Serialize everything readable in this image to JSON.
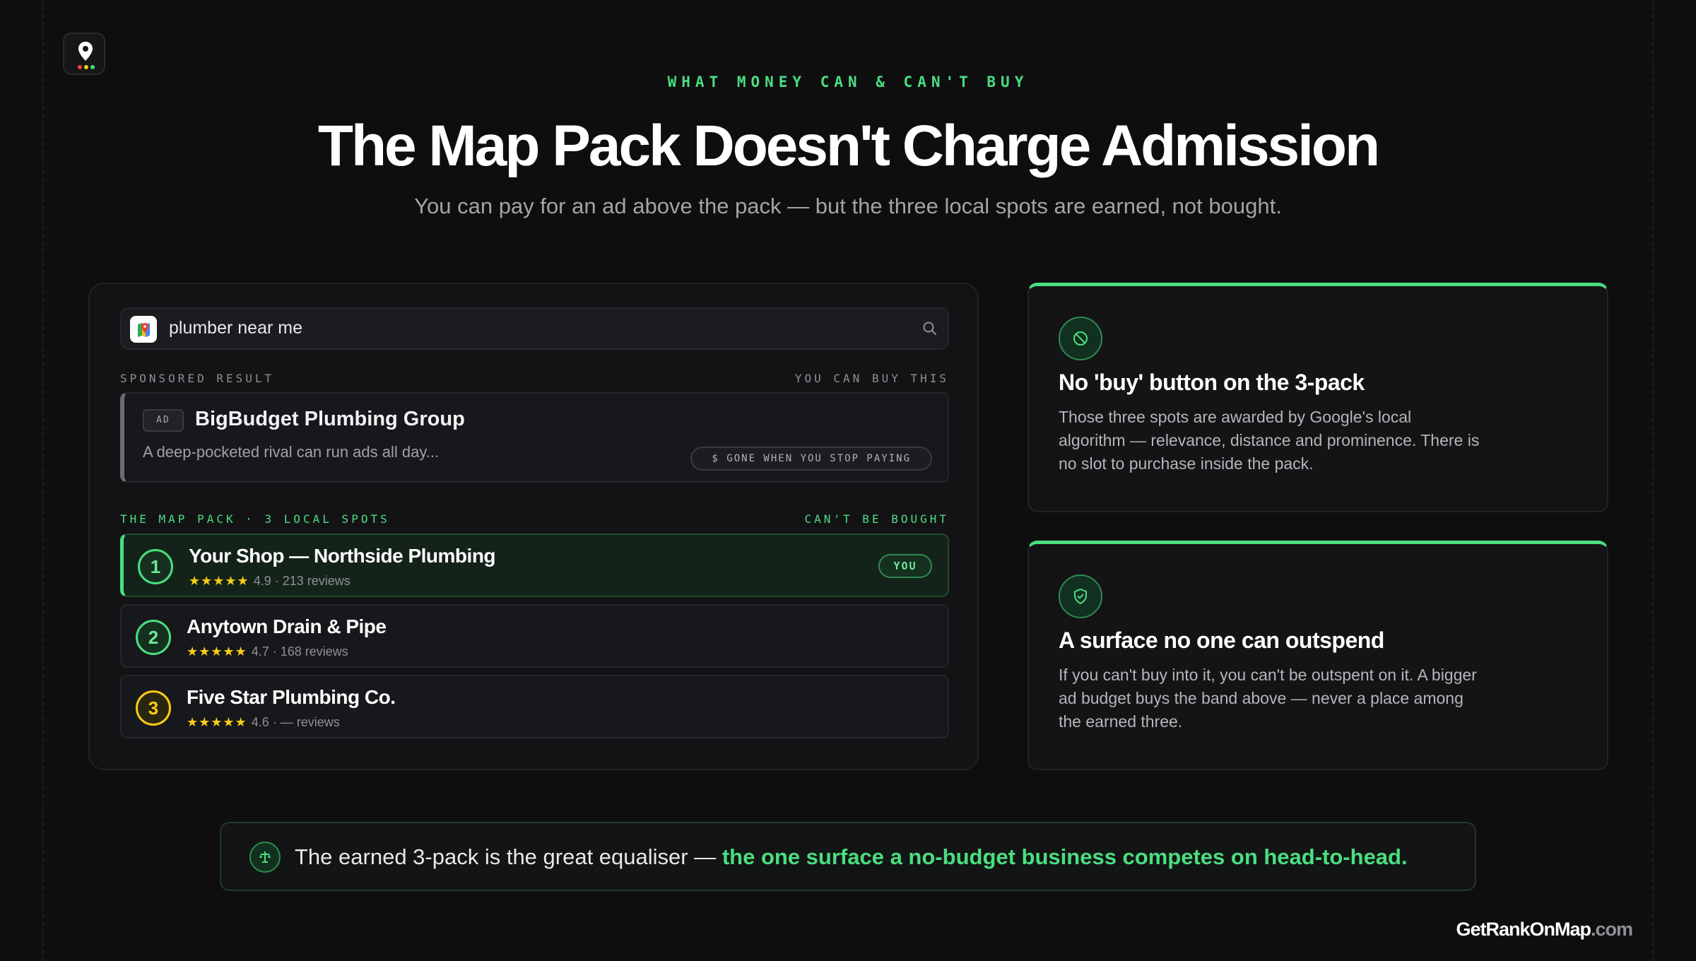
{
  "eyebrow": "WHAT MONEY CAN & CAN'T BUY",
  "title": "The Map Pack Doesn't Charge Admission",
  "subtitle": "You can pay for an ad above the pack — but the three local spots are earned, not bought.",
  "search": {
    "query": "plumber near me"
  },
  "sponsored": {
    "label": "SPONSORED RESULT",
    "right_label": "YOU CAN BUY THIS",
    "ad_tag": "AD",
    "name": "BigBudget Plumbing Group",
    "description": "A deep-pocketed rival can run ads all day...",
    "pill": "$ GONE WHEN YOU STOP PAYING"
  },
  "map_pack": {
    "label": "THE MAP PACK · 3 LOCAL SPOTS",
    "right_label": "CAN'T BE BOUGHT",
    "stars": "★★★★★",
    "spots": [
      {
        "rank": "1",
        "name": "Your Shop — Northside Plumbing",
        "meta": "4.9 · 213 reviews",
        "badge": "YOU"
      },
      {
        "rank": "2",
        "name": "Anytown Drain & Pipe",
        "meta": "4.7 · 168 reviews"
      },
      {
        "rank": "3",
        "name": "Five Star Plumbing Co.",
        "meta": "4.6 · — reviews"
      }
    ]
  },
  "cards": [
    {
      "icon": "ban-icon",
      "title": "No 'buy' button on the 3-pack",
      "body": "Those three spots are awarded by Google's local algorithm — relevance, distance and prominence. There is no slot to purchase inside the pack."
    },
    {
      "icon": "shield-check-icon",
      "title": "A surface no one can outspend",
      "body": "If you can't buy into it, you can't be outspent on it. A bigger ad budget buys the band above — never a place among the earned three."
    }
  ],
  "banner": {
    "icon": "balance-icon",
    "text": "The earned 3-pack is the great equaliser — ",
    "highlight": "the one surface a no-budget business competes on head-to-head."
  },
  "brand": {
    "name": "GetRankOnMap",
    "domain": ".com"
  },
  "colors": {
    "accent": "#4ade80",
    "gold": "#facc15",
    "background": "#0e0e0f"
  }
}
